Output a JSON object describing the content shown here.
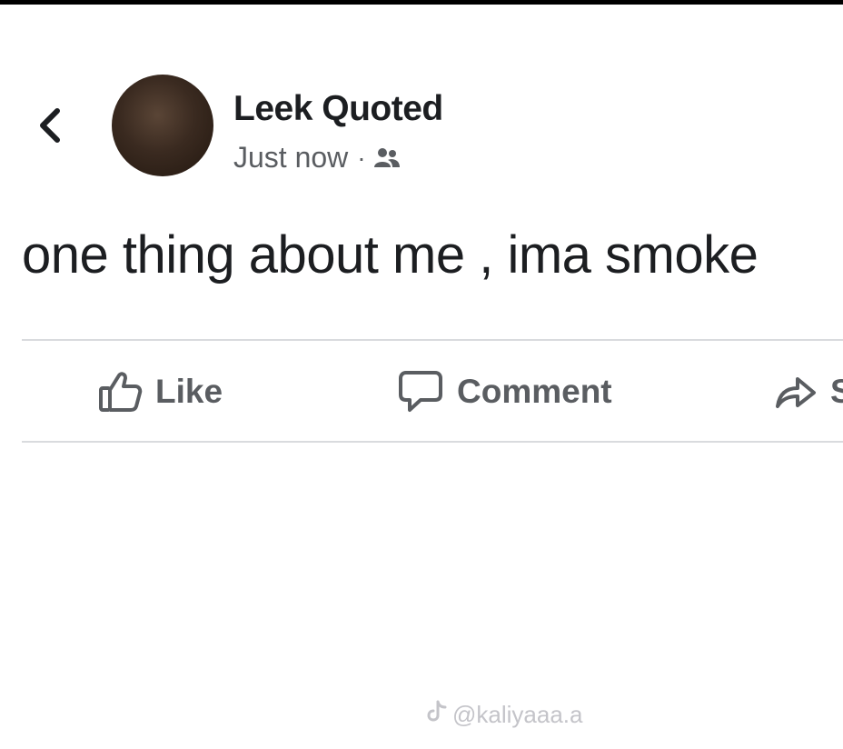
{
  "post": {
    "author": "Leek Quoted",
    "timestamp": "Just now",
    "separator": "·",
    "audience_icon": "friends-icon",
    "text": "one thing about me , ima smoke"
  },
  "actions": {
    "like_label": "Like",
    "comment_label": "Comment",
    "share_label": "Share"
  },
  "watermark": {
    "text": "@kaliyaaa.a",
    "icon": "tiktok-icon"
  },
  "colors": {
    "text_primary": "#1c1e21",
    "text_secondary": "#5a5d61",
    "divider": "#d9dbde",
    "background": "#ffffff"
  }
}
